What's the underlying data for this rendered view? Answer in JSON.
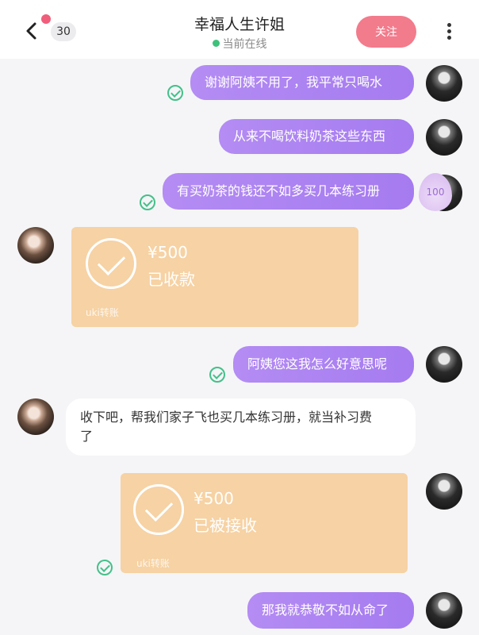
{
  "header": {
    "unread_count": "30",
    "title": "幸福人生许姐",
    "status": "当前在线",
    "follow_label": "关注"
  },
  "messages": [
    {
      "type": "text",
      "from": "me",
      "text": "谢谢阿姨不用了，我平常只喝水",
      "read": true
    },
    {
      "type": "text",
      "from": "me",
      "text": "从来不喝饮料奶茶这些东西",
      "read": false
    },
    {
      "type": "text",
      "from": "me",
      "text": "有买奶茶的钱还不如多买几本练习册",
      "read": true
    },
    {
      "type": "transfer",
      "from": "her",
      "amount": "¥500",
      "state": "已收款",
      "brand": "uki转账"
    },
    {
      "type": "text",
      "from": "me",
      "text": "阿姨您这我怎么好意思呢",
      "read": true
    },
    {
      "type": "text",
      "from": "her",
      "text_line1": "收下吧，帮我们家子飞也买几本练习册，就当补习费",
      "text_line2": "了"
    },
    {
      "type": "transfer",
      "from": "me",
      "amount": "¥500",
      "state": "已被接收",
      "brand": "uki转账",
      "read": true
    },
    {
      "type": "text",
      "from": "me",
      "text": "那我就恭敬不如从命了",
      "read": false
    }
  ],
  "badge": {
    "value": "100"
  },
  "colors": {
    "accent": "#f27b8c",
    "bubble_mine": "#ad84f1",
    "transfer": "#f6d2a4",
    "online": "#3cc27b"
  }
}
